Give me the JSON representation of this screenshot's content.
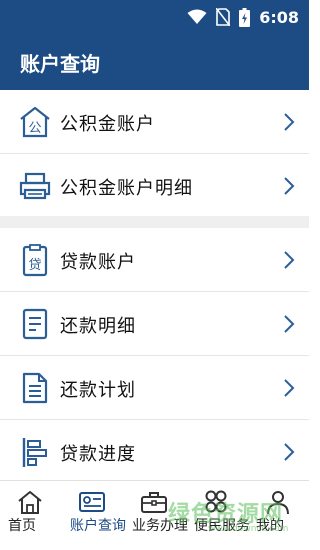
{
  "status_bar": {
    "time": "6:08",
    "icons": [
      "wifi-icon",
      "no-sim-icon",
      "battery-charging-icon"
    ]
  },
  "header": {
    "title": "账户查询",
    "background": "#1d4c84"
  },
  "menu": {
    "items": [
      {
        "label": "公积金账户",
        "icon": "fund-account-icon"
      },
      {
        "label": "公积金账户明细",
        "icon": "printer-icon"
      },
      {
        "label": "贷款账户",
        "icon": "loan-clipboard-icon"
      },
      {
        "label": "还款明细",
        "icon": "document-list-icon"
      },
      {
        "label": "还款计划",
        "icon": "plan-document-icon"
      },
      {
        "label": "贷款进度",
        "icon": "progress-bars-icon"
      }
    ]
  },
  "tabbar": {
    "active_color": "#1d4c84",
    "tabs": [
      {
        "label": "首页",
        "icon": "home-icon"
      },
      {
        "label": "账户查询",
        "icon": "id-card-icon"
      },
      {
        "label": "业务办理",
        "icon": "briefcase-icon"
      },
      {
        "label": "便民服务",
        "icon": "clover-icon"
      },
      {
        "label": "我的",
        "icon": "user-icon"
      }
    ]
  },
  "watermark": {
    "text": "绿色资源网",
    "sub": "www.downcc.com"
  }
}
